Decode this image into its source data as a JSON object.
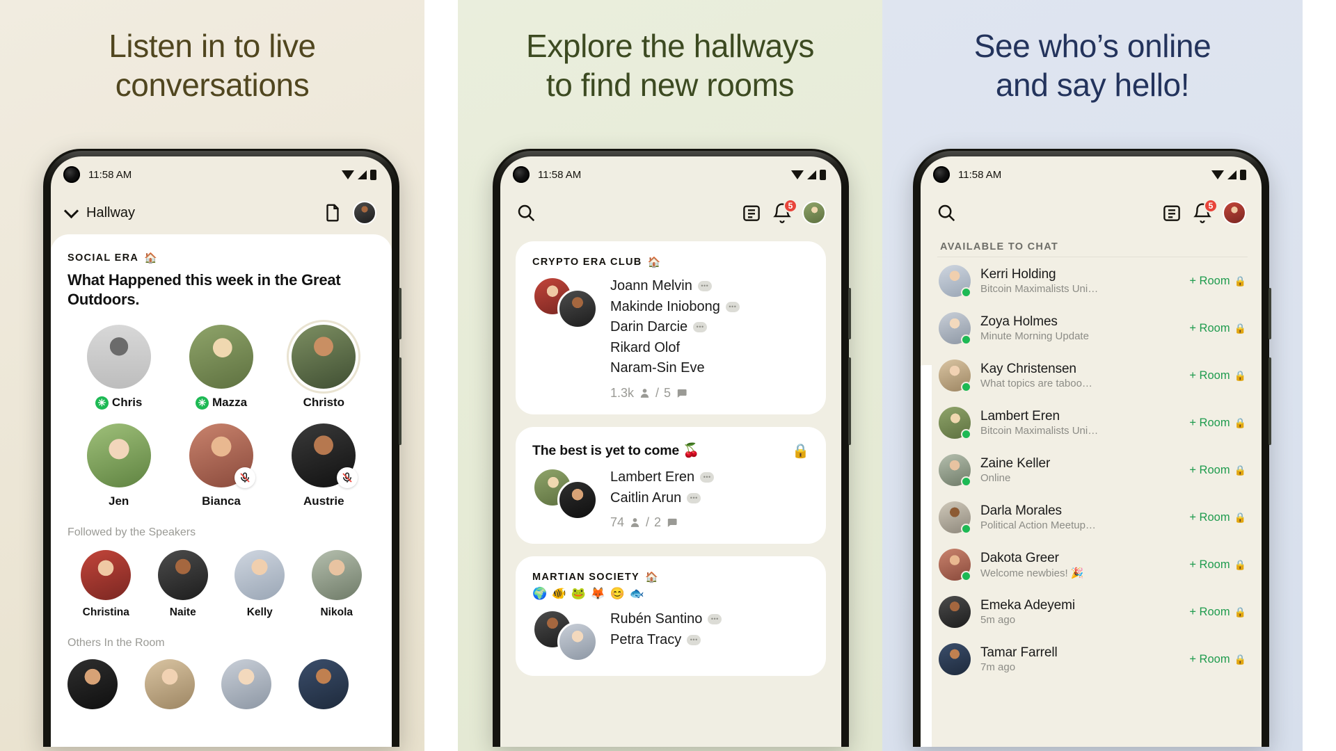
{
  "panels": [
    {
      "headline": "Listen in to live\nconversations",
      "bg": "#ece6d6",
      "heading_color": "#50461f"
    },
    {
      "headline": "Explore the hallways\nto find new rooms",
      "bg": "#e6ebd6",
      "heading_color": "#3c4a21"
    },
    {
      "headline": "See who’s online\nand say hello!",
      "bg": "#dbe2ee",
      "heading_color": "#23335c"
    }
  ],
  "status_bar": {
    "time": "11:58 AM"
  },
  "phone1": {
    "appbar": {
      "title": "Hallway",
      "chevron_icon": "chevron-down-icon",
      "doc_icon": "document-icon",
      "avatar": "user-avatar"
    },
    "room": {
      "club": "SOCIAL ERA",
      "house_icon": "🏠",
      "title": "What Happened this week in the Great Outdoors.",
      "speakers": [
        {
          "name": "Chris",
          "moderator": true,
          "muted": false,
          "face": "f-a"
        },
        {
          "name": "Mazza",
          "moderator": true,
          "muted": false,
          "face": "f-b"
        },
        {
          "name": "Christo",
          "moderator": false,
          "muted": false,
          "face": "f-c",
          "ring": true
        },
        {
          "name": "Jen",
          "moderator": false,
          "muted": false,
          "face": "f-d"
        },
        {
          "name": "Bianca",
          "moderator": false,
          "muted": true,
          "face": "f-e"
        },
        {
          "name": "Austrie",
          "moderator": false,
          "muted": true,
          "face": "f-f"
        }
      ],
      "followed_label": "Followed by the Speakers",
      "followed": [
        {
          "name": "Christina",
          "face": "f-g"
        },
        {
          "name": "Naite",
          "face": "f-k"
        },
        {
          "name": "Kelly",
          "face": "f-i"
        },
        {
          "name": "Nikola",
          "face": "f-l"
        }
      ],
      "others_label": "Others In the Room",
      "others": [
        {
          "face": "f-m"
        },
        {
          "face": "f-j"
        },
        {
          "face": "f-n"
        },
        {
          "face": "f-h"
        }
      ]
    }
  },
  "phone2": {
    "appbar": {
      "search_icon": "search-icon",
      "calendar_icon": "calendar-icon",
      "bell_icon": "bell-icon",
      "bell_badge": "5",
      "avatar": "user-avatar"
    },
    "cards": [
      {
        "club": "CRYPTO ERA CLUB",
        "house_icon": "🏠",
        "title": "",
        "emojis": "",
        "locked": false,
        "faces": [
          "f-g",
          "f-k"
        ],
        "members": [
          {
            "name": "Joann Melvin",
            "speaking": true
          },
          {
            "name": "Makinde Iniobong",
            "speaking": true
          },
          {
            "name": "Darin Darcie",
            "speaking": true
          },
          {
            "name": "Rikard Olof",
            "speaking": false
          },
          {
            "name": "Naram-Sin Eve",
            "speaking": false
          }
        ],
        "people_count": "1.3k",
        "rooms_count": "5"
      },
      {
        "club": "",
        "house_icon": "",
        "title": "The best is yet to come 🍒",
        "emojis": "",
        "locked": true,
        "faces": [
          "f-b",
          "f-m"
        ],
        "members": [
          {
            "name": "Lambert Eren",
            "speaking": true
          },
          {
            "name": "Caitlin Arun",
            "speaking": true
          }
        ],
        "people_count": "74",
        "rooms_count": "2"
      },
      {
        "club": "MARTIAN SOCIETY",
        "house_icon": "🏠",
        "title": "",
        "emojis": "🌍 🐠 🐸 🦊 😊 🐟",
        "locked": false,
        "faces": [
          "f-k",
          "f-n"
        ],
        "members": [
          {
            "name": "Rubén Santino",
            "speaking": true
          },
          {
            "name": "Petra Tracy",
            "speaking": true
          }
        ],
        "people_count": "",
        "rooms_count": ""
      }
    ]
  },
  "phone3": {
    "appbar": {
      "search_icon": "search-icon",
      "calendar_icon": "calendar-icon",
      "bell_icon": "bell-icon",
      "bell_badge": "5",
      "avatar": "user-avatar"
    },
    "section_title": "AVAILABLE TO CHAT",
    "room_button_label": "+ Room",
    "lock_icon": "🔒",
    "people": [
      {
        "name": "Kerri Holding",
        "status": "Bitcoin Maximalists Uni…",
        "online": true,
        "face": "f-i"
      },
      {
        "name": "Zoya Holmes",
        "status": "Minute Morning Update",
        "online": true,
        "face": "f-n"
      },
      {
        "name": "Kay Christensen",
        "status": "What topics are taboo…",
        "online": true,
        "face": "f-j"
      },
      {
        "name": "Lambert Eren",
        "status": "Bitcoin Maximalists Uni…",
        "online": true,
        "face": "f-b"
      },
      {
        "name": "Zaine Keller",
        "status": "Online",
        "online": true,
        "face": "f-l"
      },
      {
        "name": "Darla Morales",
        "status": "Political Action Meetup…",
        "online": true,
        "face": "f-o"
      },
      {
        "name": "Dakota Greer",
        "status": "Welcome newbies! 🎉",
        "online": true,
        "face": "f-e"
      },
      {
        "name": "Emeka Adeyemi",
        "status": "5m ago",
        "online": false,
        "face": "f-k"
      },
      {
        "name": "Tamar Farrell",
        "status": "7m ago",
        "online": false,
        "face": "f-h"
      }
    ]
  }
}
